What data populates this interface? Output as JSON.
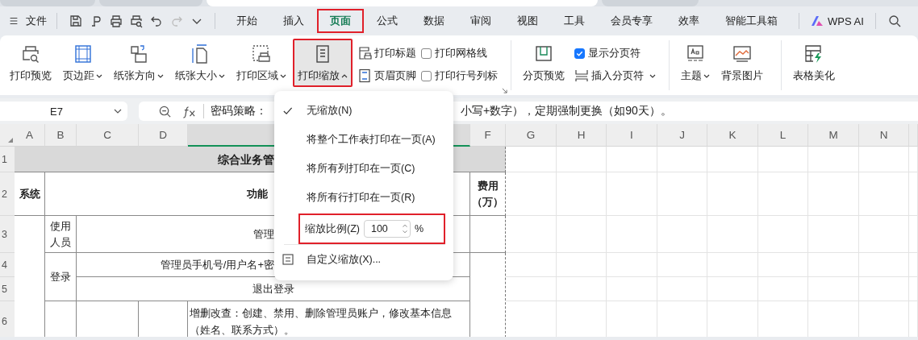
{
  "document_tabs": [
    {
      "selected": false
    },
    {
      "selected": false
    },
    {
      "selected": true
    },
    {
      "selected": false
    }
  ],
  "toolbar": {
    "file_menu": "文件",
    "tabs": [
      {
        "label": "开始",
        "selected": false,
        "highlighted": false
      },
      {
        "label": "插入",
        "selected": false,
        "highlighted": false
      },
      {
        "label": "页面",
        "selected": true,
        "highlighted": true
      },
      {
        "label": "公式",
        "selected": false,
        "highlighted": false
      },
      {
        "label": "数据",
        "selected": false,
        "highlighted": false
      },
      {
        "label": "审阅",
        "selected": false,
        "highlighted": false
      },
      {
        "label": "视图",
        "selected": false,
        "highlighted": false
      },
      {
        "label": "工具",
        "selected": false,
        "highlighted": false
      },
      {
        "label": "会员专享",
        "selected": false,
        "highlighted": false
      },
      {
        "label": "效率",
        "selected": false,
        "highlighted": false
      },
      {
        "label": "智能工具箱",
        "selected": false,
        "highlighted": false
      }
    ],
    "ai_button": "WPS AI"
  },
  "ribbon": {
    "groups": [
      {
        "columns": [
          [
            {
              "kind": "large",
              "label": "打印预览",
              "pressed": false,
              "highlighted": false
            }
          ],
          [
            {
              "kind": "large",
              "label": "页边距",
              "dropdown": true,
              "menu_open": false,
              "pressed": false,
              "highlighted": false
            }
          ],
          [
            {
              "kind": "large",
              "label": "纸张方向",
              "dropdown": true,
              "menu_open": false,
              "pressed": false,
              "highlighted": false
            }
          ],
          [
            {
              "kind": "large",
              "label": "纸张大小",
              "dropdown": true,
              "menu_open": false,
              "pressed": false,
              "highlighted": false
            }
          ],
          [
            {
              "kind": "large",
              "label": "打印区域",
              "dropdown": true,
              "menu_open": false,
              "pressed": false,
              "highlighted": false
            }
          ],
          [
            {
              "kind": "large",
              "label": "打印缩放",
              "dropdown": true,
              "menu_open": true,
              "pressed": true,
              "highlighted": true
            }
          ],
          [
            {
              "kind": "small",
              "label": "打印标题"
            },
            {
              "kind": "small",
              "label": "页眉页脚"
            }
          ],
          [
            {
              "kind": "check",
              "label": "打印网格线",
              "checked": false
            },
            {
              "kind": "check",
              "label": "打印行号列标",
              "checked": false
            }
          ]
        ]
      },
      {
        "columns": [
          [
            {
              "kind": "large",
              "label": "分页预览",
              "pressed": false,
              "highlighted": false
            }
          ],
          [
            {
              "kind": "check",
              "label": "显示分页符",
              "checked": true
            },
            {
              "kind": "small",
              "label": "插入分页符",
              "dropdown": true,
              "menu_open": false
            }
          ]
        ]
      },
      {
        "columns": [
          [
            {
              "kind": "large",
              "label": "主题",
              "dropdown": true,
              "menu_open": false,
              "pressed": false,
              "highlighted": false
            }
          ],
          [
            {
              "kind": "large",
              "label": "背景图片",
              "pressed": false,
              "highlighted": false
            }
          ]
        ]
      },
      {
        "columns": [
          [
            {
              "kind": "large",
              "label": "表格美化",
              "pressed": false,
              "highlighted": false
            }
          ]
        ]
      }
    ]
  },
  "formula_bar": {
    "name_box": "E7",
    "formula_visible_start": "密码策略：",
    "formula_visible_end": "小写+数字），定期强制更换（如90天）。"
  },
  "sheet": {
    "column_headers": [
      {
        "label": "A",
        "selected": false
      },
      {
        "label": "B",
        "selected": false
      },
      {
        "label": "C",
        "selected": false
      },
      {
        "label": "D",
        "selected": false
      },
      {
        "selected": true
      },
      {
        "label": "F",
        "selected": false
      },
      {
        "label": "G",
        "selected": false
      },
      {
        "label": "H",
        "selected": false
      },
      {
        "label": "I",
        "selected": false
      },
      {
        "label": "J",
        "selected": false
      },
      {
        "label": "K",
        "selected": false
      },
      {
        "label": "L",
        "selected": false
      },
      {
        "label": "M",
        "selected": false
      },
      {
        "label": "N",
        "selected": false
      }
    ],
    "row_headers": [
      "1",
      "2",
      "3",
      "4",
      "5",
      "6"
    ],
    "cells": [
      {
        "text": "综合业务管"
      },
      {
        "text": "系统"
      },
      {
        "text": "功能"
      },
      {
        "text": "费用（万）"
      },
      {
        "text": "使用人员"
      },
      {
        "text": "管理"
      },
      {
        "text": "登录"
      },
      {
        "text": "管理员手机号/用户名+密"
      },
      {
        "text": "退出登录"
      },
      {
        "text": "增删改查：创建、禁用、删除管理员账户，修改基本信息（姓名、联系方式）。"
      }
    ]
  },
  "zoom_menu": {
    "items": [
      {
        "kind": "option",
        "label": "无缩放(N)",
        "checked": true
      },
      {
        "kind": "option",
        "label": "将整个工作表打印在一页(A)",
        "checked": false
      },
      {
        "kind": "option",
        "label": "将所有列打印在一页(C)",
        "checked": false
      },
      {
        "kind": "option",
        "label": "将所有行打印在一页(R)",
        "checked": false
      },
      {
        "kind": "scale",
        "label": "缩放比例(Z)",
        "value": "100",
        "unit": "%",
        "highlighted": true
      },
      {
        "kind": "custom",
        "label": "自定义缩放(X)..."
      }
    ]
  }
}
